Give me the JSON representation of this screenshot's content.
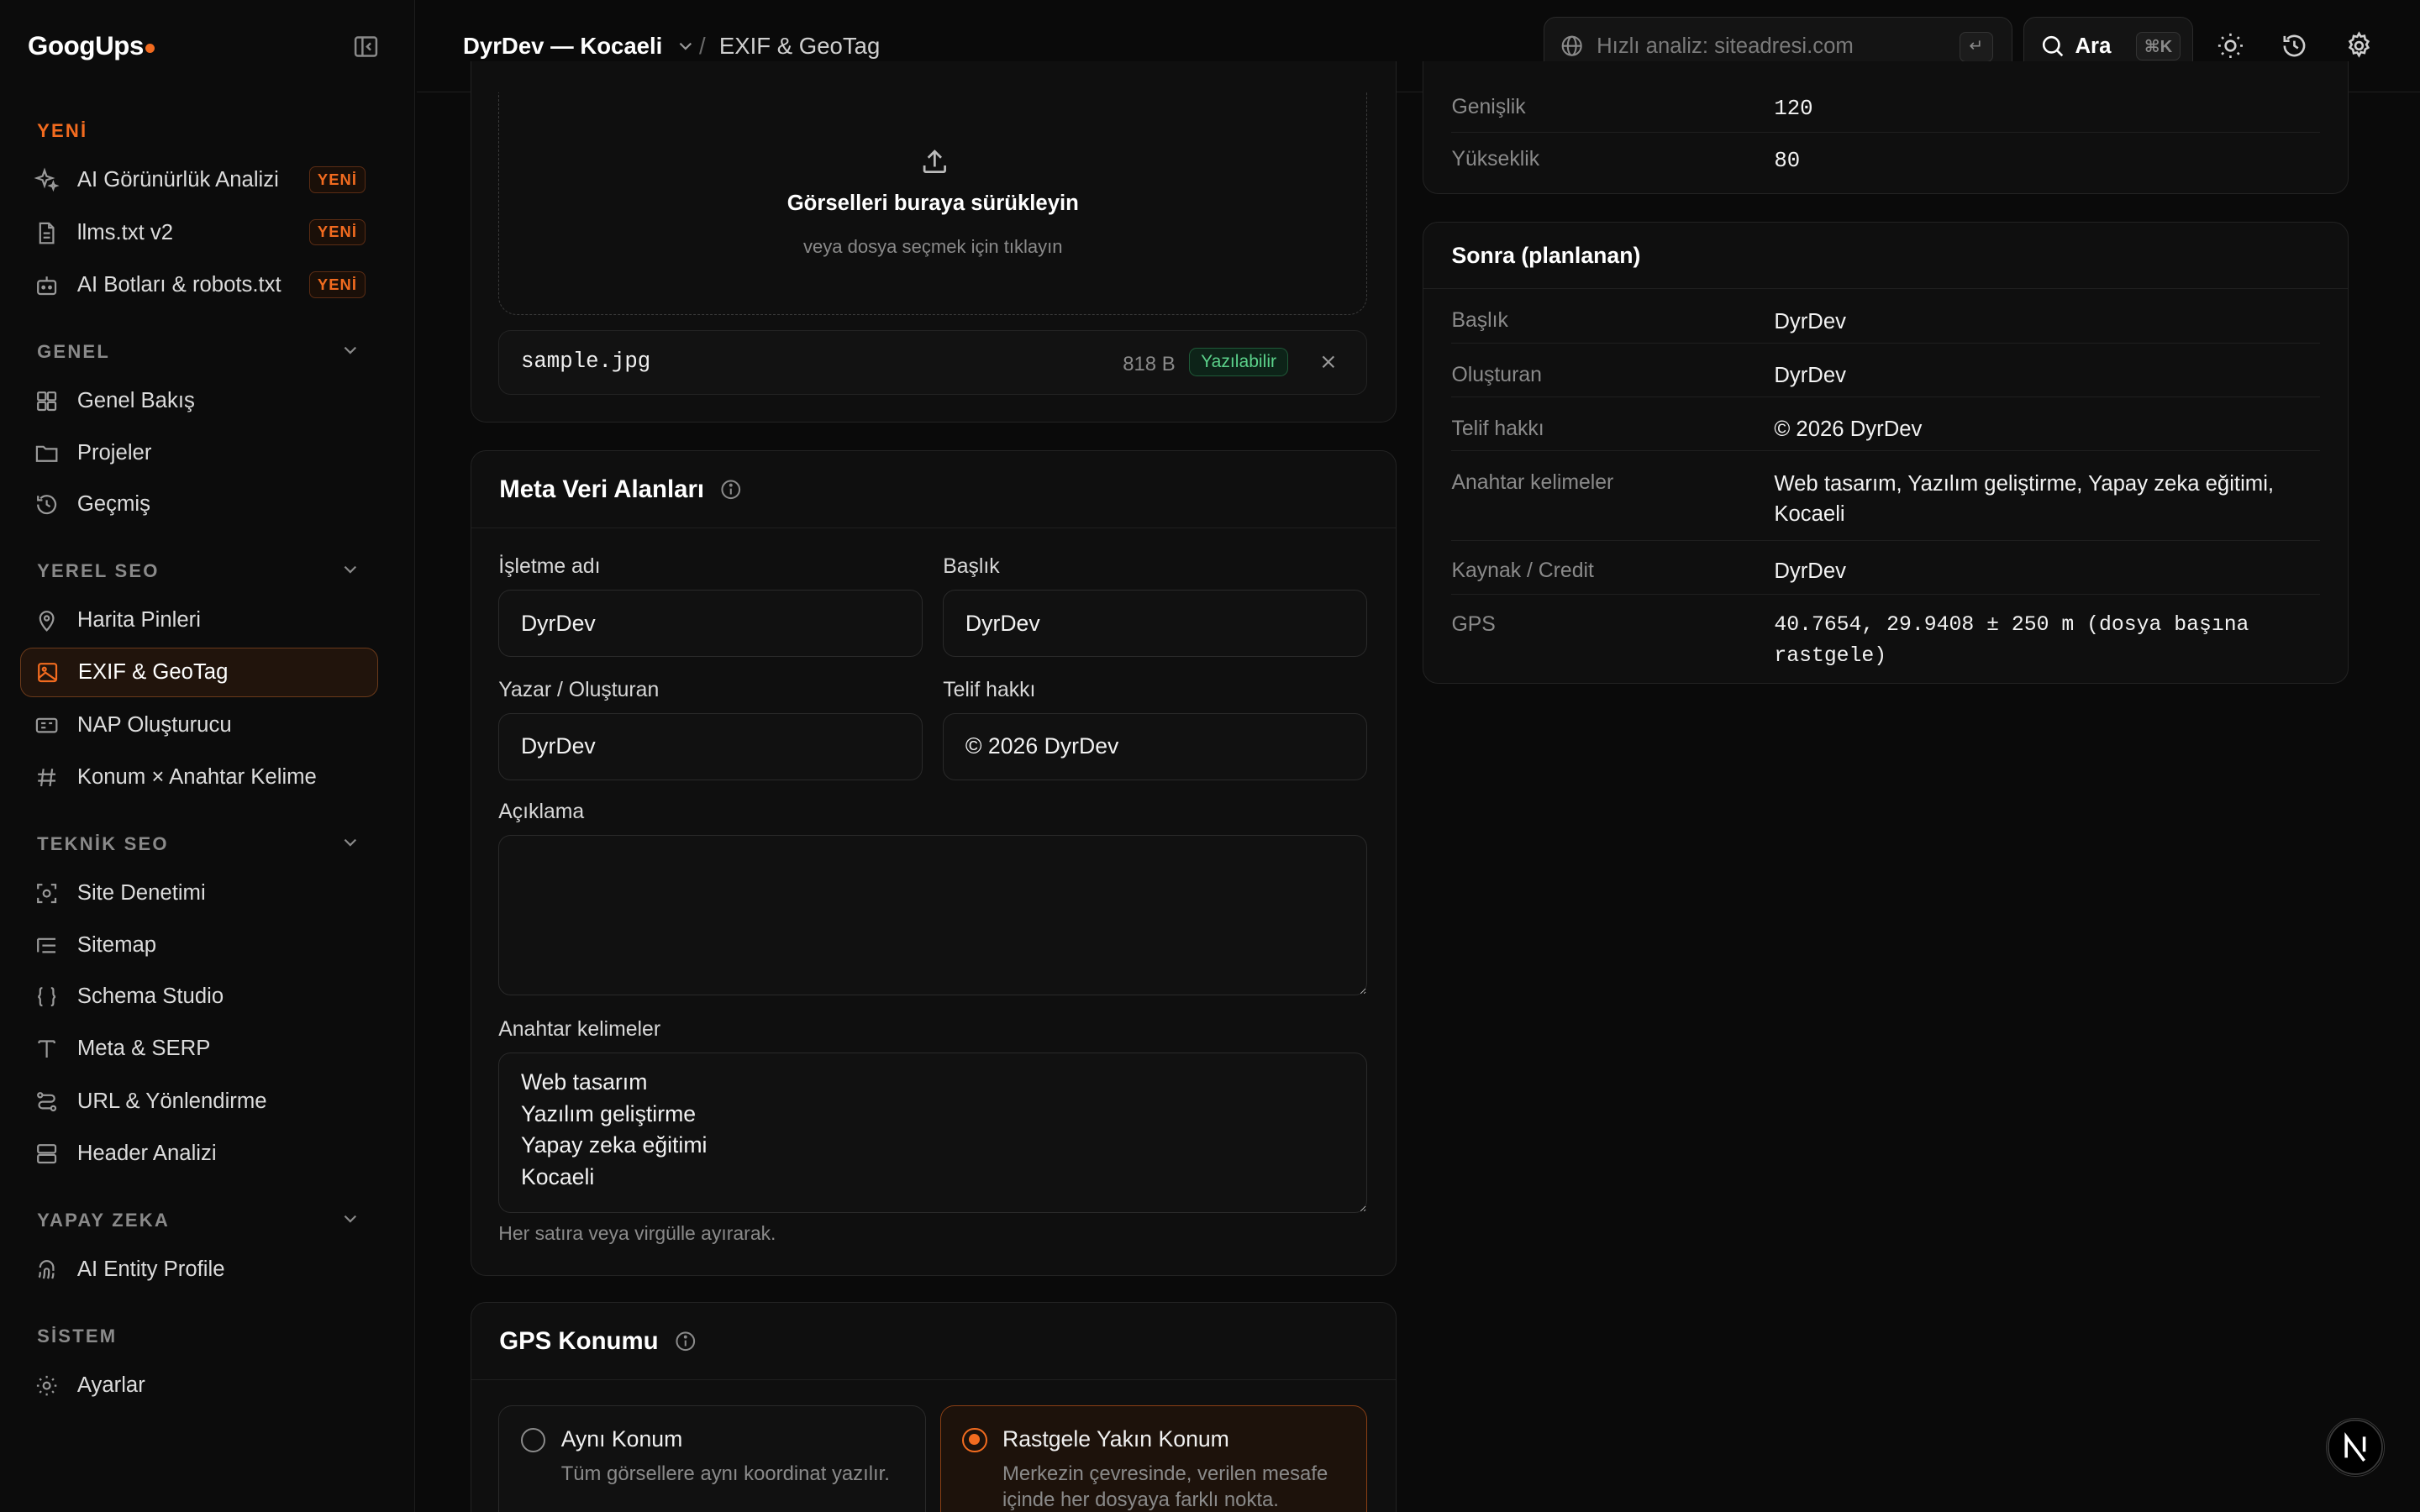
{
  "brand": {
    "name": "GoogUps"
  },
  "sidebar": {
    "sections": {
      "new": "YENİ",
      "general": "GENEL",
      "local_seo": "YEREL SEO",
      "technical_seo": "TEKNİK SEO",
      "ai": "YAPAY ZEKA",
      "system": "SİSTEM"
    },
    "new_badge": "YENİ",
    "new_items": [
      {
        "label": "AI Görünürlük Analizi",
        "icon": "sparkles-icon"
      },
      {
        "label": "llms.txt v2",
        "icon": "document-icon"
      },
      {
        "label": "AI Botları & robots.txt",
        "icon": "bot-icon"
      }
    ],
    "general_items": [
      {
        "label": "Genel Bakış",
        "icon": "dashboard-icon"
      },
      {
        "label": "Projeler",
        "icon": "folder-icon"
      },
      {
        "label": "Geçmiş",
        "icon": "history-icon"
      }
    ],
    "local_items": [
      {
        "label": "Harita Pinleri",
        "icon": "map-pin-icon"
      },
      {
        "label": "EXIF & GeoTag",
        "icon": "image-icon",
        "active": true
      },
      {
        "label": "NAP Oluşturucu",
        "icon": "id-card-icon"
      },
      {
        "label": "Konum × Anahtar Kelime",
        "icon": "hash-icon"
      }
    ],
    "technical_items": [
      {
        "label": "Site Denetimi",
        "icon": "scan-icon"
      },
      {
        "label": "Sitemap",
        "icon": "list-icon"
      },
      {
        "label": "Schema Studio",
        "icon": "braces-icon"
      },
      {
        "label": "Meta & SERP",
        "icon": "type-icon"
      },
      {
        "label": "URL & Yönlendirme",
        "icon": "route-icon"
      },
      {
        "label": "Header Analizi",
        "icon": "server-icon"
      }
    ],
    "ai_items": [
      {
        "label": "AI Entity Profile",
        "icon": "fingerprint-icon"
      }
    ],
    "system_items": [
      {
        "label": "Ayarlar",
        "icon": "gear-icon"
      }
    ]
  },
  "topbar": {
    "project": "DyrDev — Kocaeli",
    "separator": "/",
    "page": "EXIF & GeoTag",
    "quick_placeholder": "Hızlı analiz: siteadresi.com",
    "enter_key": "↵",
    "search_label": "Ara",
    "search_shortcut": "⌘K"
  },
  "upload": {
    "drop_title": "Görselleri buraya sürükleyin",
    "drop_subtitle": "veya dosya seçmek için tıklayın",
    "file": {
      "name": "sample.jpg",
      "size": "818 B",
      "status": "Yazılabilir"
    }
  },
  "meta_fields": {
    "title": "Meta Veri Alanları",
    "business_label": "İşletme adı",
    "business_value": "DyrDev",
    "heading_label": "Başlık",
    "heading_value": "DyrDev",
    "author_label": "Yazar / Oluşturan",
    "author_value": "DyrDev",
    "copyright_label": "Telif hakkı",
    "copyright_value": "© 2026 DyrDev",
    "description_label": "Açıklama",
    "description_value": "",
    "keywords_label": "Anahtar kelimeler",
    "keywords_value": "Web tasarım\nYazılım geliştirme\nYapay zeka eğitimi\nKocaeli",
    "keywords_hint": "Her satıra veya virgülle ayırarak."
  },
  "gps": {
    "title": "GPS Konumu",
    "options": [
      {
        "title": "Aynı Konum",
        "desc": "Tüm görsellere aynı koordinat yazılır.",
        "selected": false
      },
      {
        "title": "Rastgele Yakın Konum",
        "desc": "Merkezin çevresinde, verilen mesafe içinde her dosyaya farklı nokta.",
        "selected": true
      }
    ]
  },
  "current": {
    "rows": [
      {
        "key": "Genişlik",
        "value": "120"
      },
      {
        "key": "Yükseklik",
        "value": "80"
      }
    ]
  },
  "planned": {
    "title": "Sonra (planlanan)",
    "rows": [
      {
        "key": "Başlık",
        "value": "DyrDev"
      },
      {
        "key": "Oluşturan",
        "value": "DyrDev"
      },
      {
        "key": "Telif hakkı",
        "value": "© 2026 DyrDev"
      },
      {
        "key": "Anahtar kelimeler",
        "value": "Web tasarım, Yazılım geliştirme, Yapay zeka eğitimi, Kocaeli"
      },
      {
        "key": "Kaynak / Credit",
        "value": "DyrDev"
      },
      {
        "key": "GPS",
        "value": "40.7654, 29.9408 ± 250 m (dosya başına rastgele)"
      }
    ]
  },
  "colors": {
    "accent": "#f26b1f",
    "success": "#5bd18a",
    "background": "#0a0a0a"
  }
}
